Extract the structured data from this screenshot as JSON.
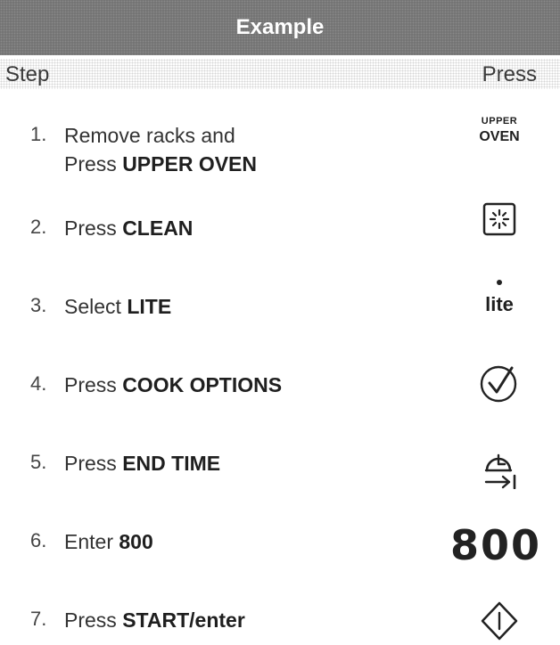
{
  "header": {
    "title": "Example"
  },
  "columns": {
    "step": "Step",
    "press": "Press"
  },
  "steps": [
    {
      "number": "1.",
      "line1": "Remove racks and",
      "prefix": "Press ",
      "bold": "UPPER OVEN",
      "icon": "upper-oven-label",
      "icon_text_1": "UPPER",
      "icon_text_2": "OVEN"
    },
    {
      "number": "2.",
      "prefix": "Press ",
      "bold": "CLEAN",
      "icon": "clean-icon"
    },
    {
      "number": "3.",
      "prefix": "Select ",
      "bold": "LITE",
      "icon": "lite-label",
      "icon_text": "lite"
    },
    {
      "number": "4.",
      "prefix": "Press ",
      "bold": "COOK OPTIONS",
      "icon": "check-circle-icon"
    },
    {
      "number": "5.",
      "prefix": "Press ",
      "bold": "END TIME",
      "icon": "end-time-icon"
    },
    {
      "number": "6.",
      "prefix": "Enter ",
      "bold": "800",
      "icon": "digits-label",
      "icon_text": "800"
    },
    {
      "number": "7.",
      "prefix": "Press ",
      "bold": "START/enter",
      "icon": "start-icon"
    }
  ]
}
